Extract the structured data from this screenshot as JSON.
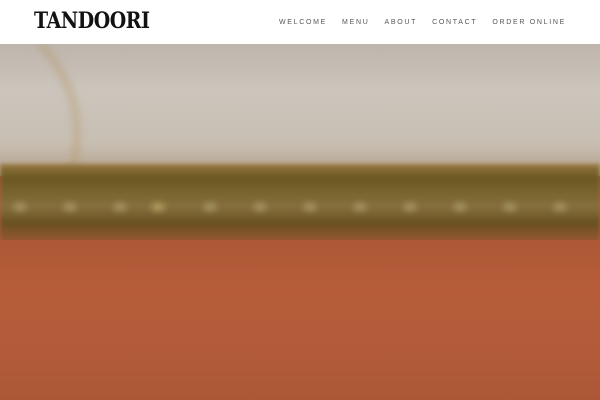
{
  "header": {
    "logo_text": "TANDOORI"
  },
  "nav": {
    "items": [
      {
        "label": "WELCOME"
      },
      {
        "label": "MENU"
      },
      {
        "label": "ABOUT"
      },
      {
        "label": "CONTACT"
      },
      {
        "label": "ORDER ONLINE"
      }
    ]
  },
  "colors": {
    "header_background": "#ffffff",
    "nav_text": "#555555",
    "logo_text": "#121212",
    "hero_wall": "#b95e3b",
    "hero_ceiling": "#d2ccc3",
    "hero_trim": "#7f6a33"
  }
}
